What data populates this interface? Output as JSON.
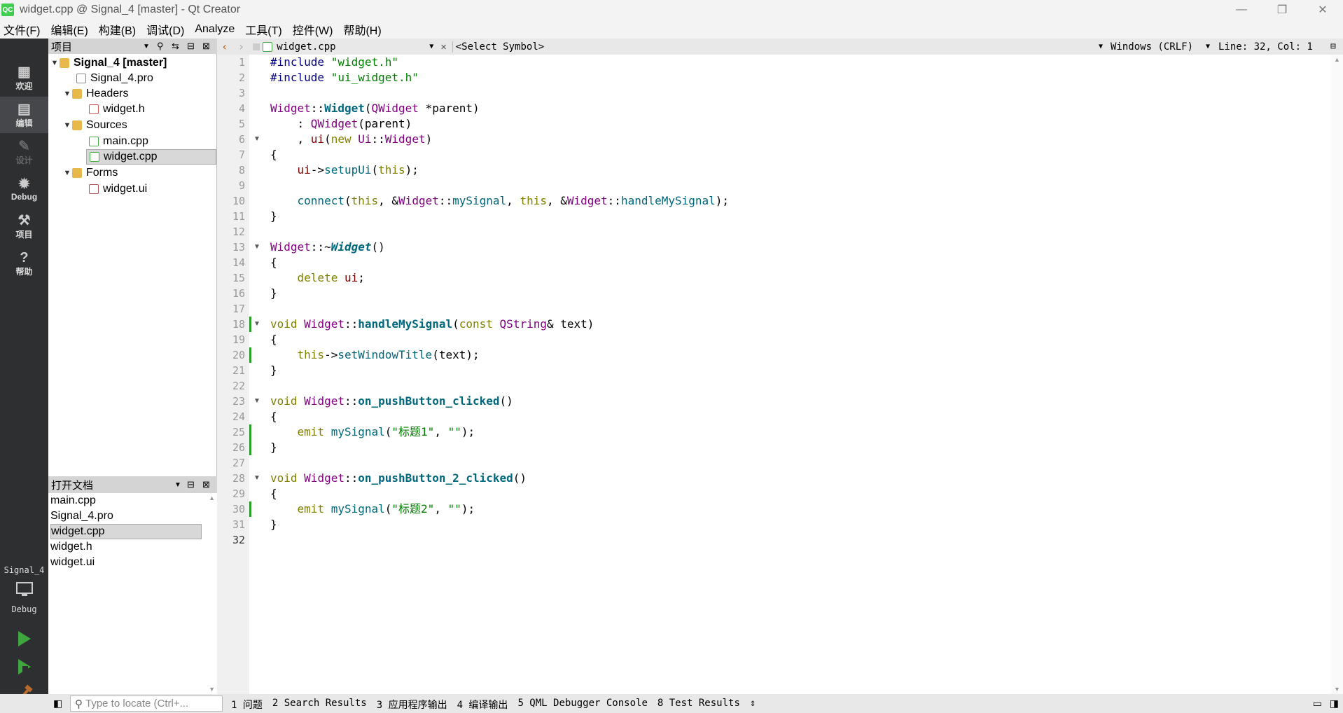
{
  "window": {
    "title": "widget.cpp @ Signal_4 [master] - Qt Creator",
    "app_icon": "QC",
    "minimize": "—",
    "restore": "❐",
    "close": "✕"
  },
  "menu": [
    "文件(F)",
    "编辑(E)",
    "构建(B)",
    "调试(D)",
    "Analyze",
    "工具(T)",
    "控件(W)",
    "帮助(H)"
  ],
  "modes": [
    {
      "label": "欢迎",
      "icon": "grid-icon"
    },
    {
      "label": "编辑",
      "icon": "edit-icon"
    },
    {
      "label": "设计",
      "icon": "pencil-icon"
    },
    {
      "label": "Debug",
      "icon": "bug-icon"
    },
    {
      "label": "项目",
      "icon": "wrench-icon"
    },
    {
      "label": "帮助",
      "icon": "help-icon"
    }
  ],
  "kit": {
    "project": "Signal_4",
    "config": "Debug"
  },
  "project_pane": {
    "title": "项目"
  },
  "tree": [
    {
      "label": "Signal_4 [master]"
    },
    {
      "label": "Signal_4.pro"
    },
    {
      "label": "Headers"
    },
    {
      "label": "widget.h"
    },
    {
      "label": "Sources"
    },
    {
      "label": "main.cpp"
    },
    {
      "label": "widget.cpp"
    },
    {
      "label": "Forms"
    },
    {
      "label": "widget.ui"
    }
  ],
  "open_docs": {
    "title": "打开文档",
    "items": [
      "main.cpp",
      "Signal_4.pro",
      "widget.cpp",
      "widget.h",
      "widget.ui"
    ]
  },
  "editor": {
    "file": "widget.cpp",
    "symbol": "<Select Symbol>",
    "encoding": "Windows (CRLF)",
    "position": "Line: 32, Col: 1"
  },
  "line_numbers": [
    "1",
    "2",
    "3",
    "4",
    "5",
    "6",
    "7",
    "8",
    "9",
    "10",
    "11",
    "12",
    "13",
    "14",
    "15",
    "16",
    "17",
    "18",
    "19",
    "20",
    "21",
    "22",
    "23",
    "24",
    "25",
    "26",
    "27",
    "28",
    "29",
    "30",
    "31",
    "32"
  ],
  "locator": {
    "placeholder": "Type to locate (Ctrl+..."
  },
  "output_tabs": [
    "1 问题",
    "2 Search Results",
    "3 应用程序输出",
    "4 编译输出",
    "5 QML Debugger Console",
    "8 Test Results"
  ]
}
